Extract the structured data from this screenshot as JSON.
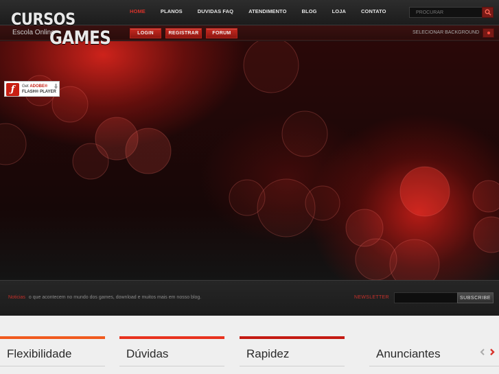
{
  "logo": {
    "line1": "CURSOS",
    "line2": "GAMES",
    "subtitle": "Escola Online"
  },
  "nav": {
    "items": [
      "HOME",
      "PLANOS",
      "DUVIDAS FAQ",
      "ATENDIMENTO",
      "BLOG",
      "LOJA",
      "CONTATO"
    ],
    "active_index": 0
  },
  "search": {
    "placeholder": "PROCURAR"
  },
  "account_buttons": {
    "login": "LOGIN",
    "register": "REGISTRAR",
    "forum": "FORUM"
  },
  "background_selector": {
    "label": "SELECIONAR BACKGROUND"
  },
  "flash_badge": {
    "line1_prefix": "Get",
    "line1_brand": "ADOBE®",
    "line2": "FLASH® PLAYER"
  },
  "news_strip": {
    "keyword": "Noticias",
    "text": "o que acontecem no mundo dos games, download e muitos mais em nosso blog."
  },
  "newsletter": {
    "label": "NEWSLETTER",
    "button": "SUBSCRIBE"
  },
  "features": [
    {
      "title": "Flexibilidade",
      "accent": "#f05a1e"
    },
    {
      "title": "Dúvidas",
      "accent": "#e8321e"
    },
    {
      "title": "Rapidez",
      "accent": "#c41a12"
    },
    {
      "title": "Anunciantes",
      "accent": ""
    }
  ],
  "colors": {
    "accent": "#d8322a",
    "hero_red": "#c81e16",
    "strip_bg": "#222222",
    "features_bg": "#efefef"
  }
}
